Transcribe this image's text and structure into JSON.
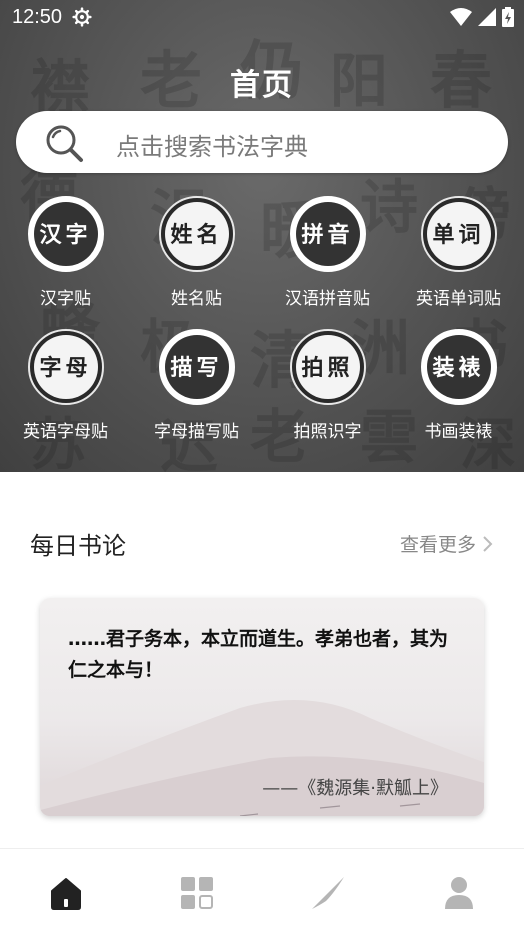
{
  "status_bar": {
    "time": "12:50"
  },
  "header": {
    "title": "首页"
  },
  "search": {
    "placeholder": "点击搜索书法字典"
  },
  "features": [
    {
      "icon_text": "汉字",
      "label": "汉字贴",
      "style": "light"
    },
    {
      "icon_text": "姓名",
      "label": "姓名贴",
      "style": "dark"
    },
    {
      "icon_text": "拼音",
      "label": "汉语拼音贴",
      "style": "light"
    },
    {
      "icon_text": "单词",
      "label": "英语单词贴",
      "style": "dark"
    },
    {
      "icon_text": "字母",
      "label": "英语字母贴",
      "style": "dark"
    },
    {
      "icon_text": "描写",
      "label": "字母描写贴",
      "style": "light"
    },
    {
      "icon_text": "拍照",
      "label": "拍照识字",
      "style": "dark"
    },
    {
      "icon_text": "装裱",
      "label": "书画装裱",
      "style": "light"
    }
  ],
  "daily": {
    "heading": "每日书论",
    "more_label": "查看更多",
    "quote": "……君子务本，本立而道生。孝弟也者，其为仁之本与！",
    "source": "——《魏源集·默觚上》"
  },
  "nav": [
    {
      "icon": "home-icon",
      "active": true
    },
    {
      "icon": "grid-icon",
      "active": false
    },
    {
      "icon": "brush-icon",
      "active": false
    },
    {
      "icon": "user-icon",
      "active": false
    }
  ],
  "colors": {
    "accent": "#222222",
    "inactive_nav": "#b5b5b5"
  }
}
